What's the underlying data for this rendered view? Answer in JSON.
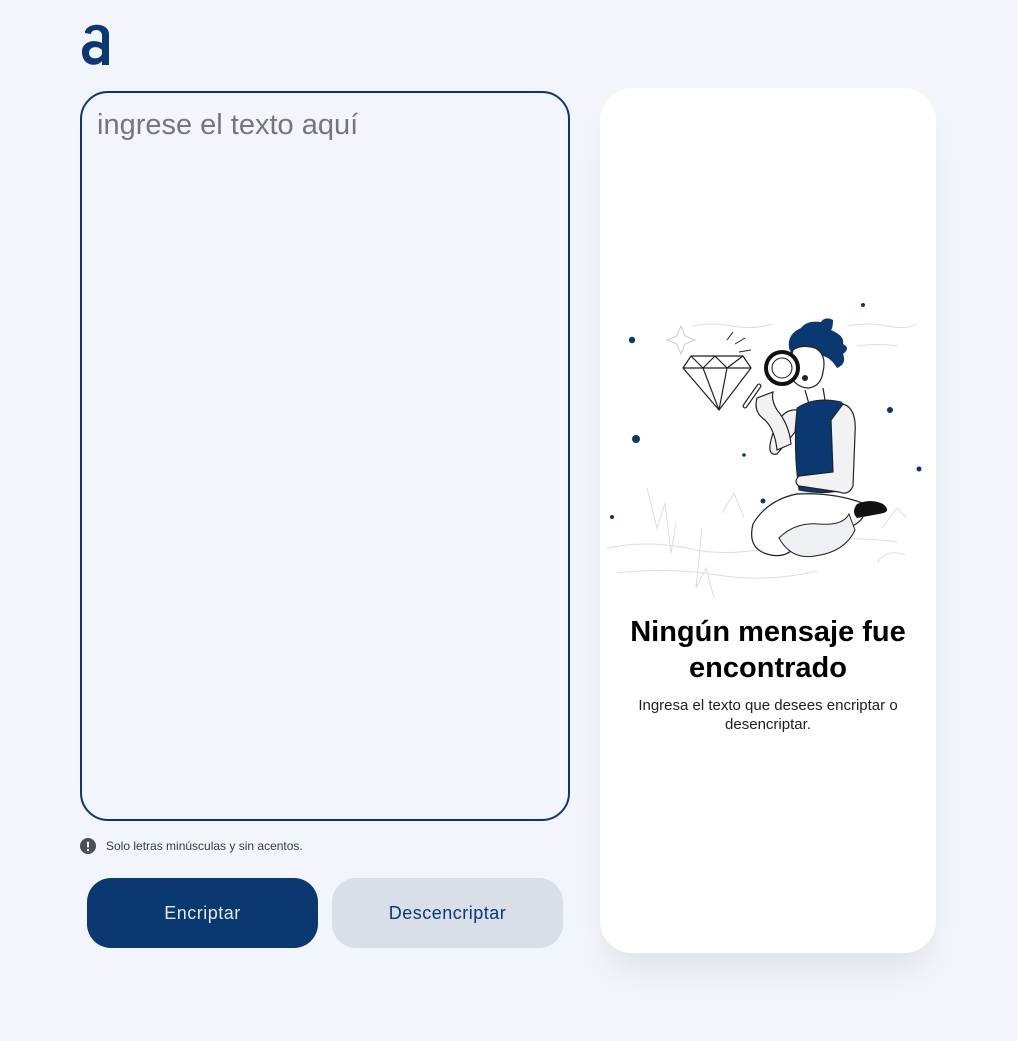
{
  "brand": {
    "logo_letter": "a",
    "color": "#0a3871"
  },
  "input": {
    "placeholder": "ingrese el texto aquí",
    "value": ""
  },
  "hint": {
    "icon": "exclamation-circle-icon",
    "text": "Solo letras minúsculas y sin acentos."
  },
  "actions": {
    "encrypt_label": "Encriptar",
    "decrypt_label": "Descencriptar",
    "encrypt_color": "#0a3871",
    "decrypt_color": "#d8dfe8"
  },
  "output": {
    "illustration": "person-with-magnifying-glass-diamond-illustration",
    "empty_title": "Ningún mensaje fue encontrado",
    "empty_subtitle": "Ingresa el texto que desees encriptar o desencriptar."
  }
}
